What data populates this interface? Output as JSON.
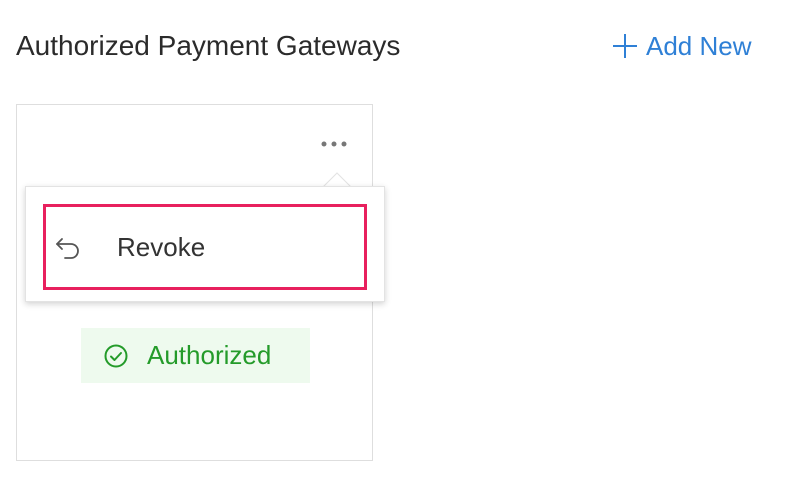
{
  "header": {
    "title": "Authorized Payment Gateways",
    "add_new_label": "Add New",
    "add_icon": "plus-icon"
  },
  "card": {
    "more_icon": "more-horizontal-icon",
    "menu": {
      "items": [
        {
          "label": "Revoke",
          "icon": "undo-icon"
        }
      ]
    },
    "status": {
      "label": "Authorized",
      "icon": "check-circle-icon"
    }
  },
  "colors": {
    "accent": "#2f80d6",
    "highlight_border": "#e8205e",
    "status_text": "#249b2a",
    "status_bg": "#eefaee"
  }
}
